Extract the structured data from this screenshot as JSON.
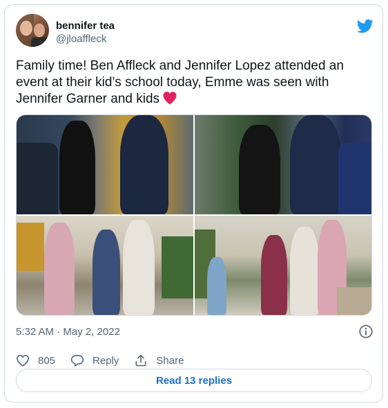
{
  "tweet": {
    "author": {
      "display_name": "bennifer tea",
      "handle": "@jloaffleck"
    },
    "text": "Family time! Ben Affleck and Jennifer Lopez attended an event at their kid’s school today, Emme was seen with Jennifer Garner and kids",
    "photos": [
      {
        "scene": "ben-jlo-walking-holding-hands"
      },
      {
        "scene": "ben-jlo-walking-rear-view"
      },
      {
        "scene": "jennifer-garner-kids-walking"
      },
      {
        "scene": "kids-walking-school"
      }
    ],
    "timestamp": "5:32 AM · May 2, 2022",
    "actions": {
      "like_count": "805",
      "reply_label": "Reply",
      "share_label": "Share"
    },
    "read_replies_label": "Read 13 replies"
  },
  "colors": {
    "twitter_blue": "#1d9bf0",
    "heart_red": "#e0245e",
    "link_blue": "#1d6fc8",
    "secondary_text": "#536471"
  },
  "icons": [
    "twitter-bird-icon",
    "red-heart-emoji-icon",
    "info-icon",
    "heart-outline-icon",
    "reply-bubble-icon",
    "share-icon"
  ]
}
